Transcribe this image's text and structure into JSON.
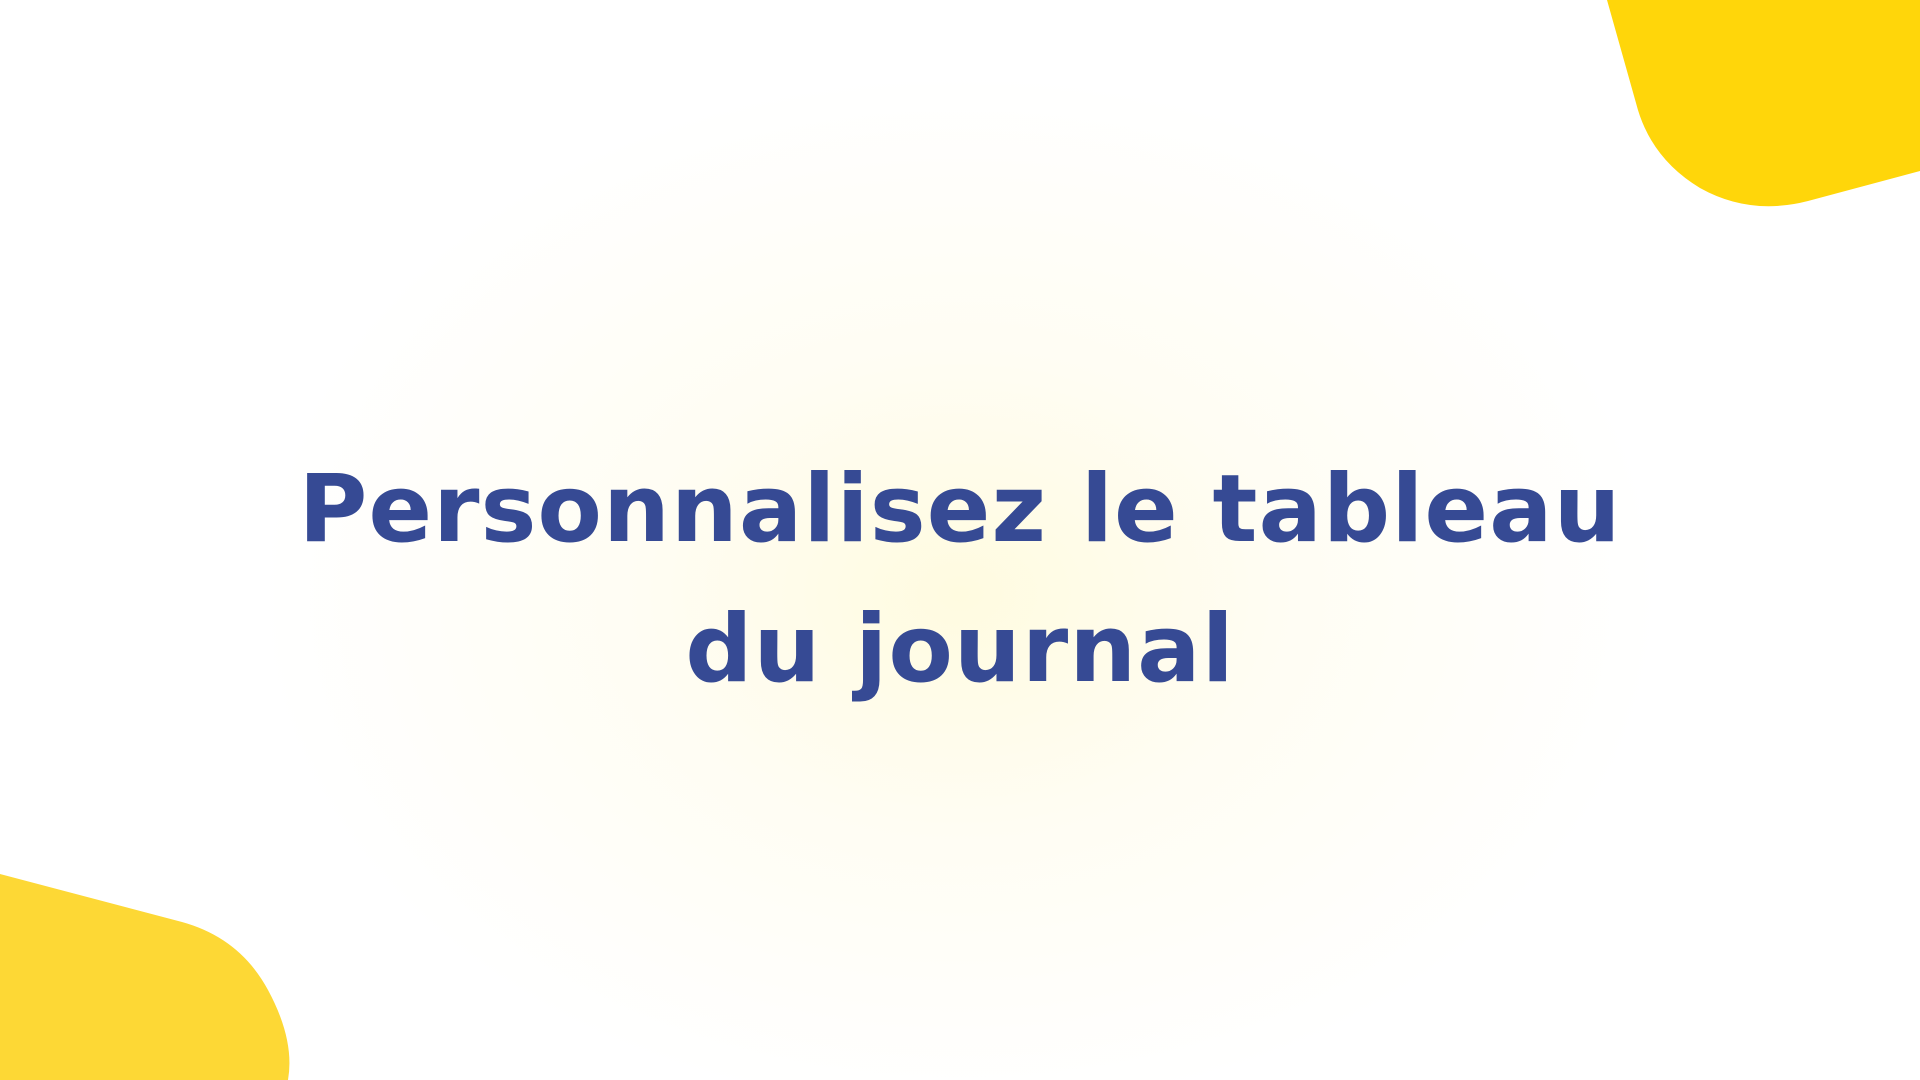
{
  "slide": {
    "title": "Personnalisez le tableau du journal"
  },
  "colors": {
    "background": "#ffffff",
    "glow": "#fffbe0",
    "accent_yellow": "#ffd60a",
    "accent_yellow_light": "#fdd835",
    "title_text": "#364a94"
  }
}
